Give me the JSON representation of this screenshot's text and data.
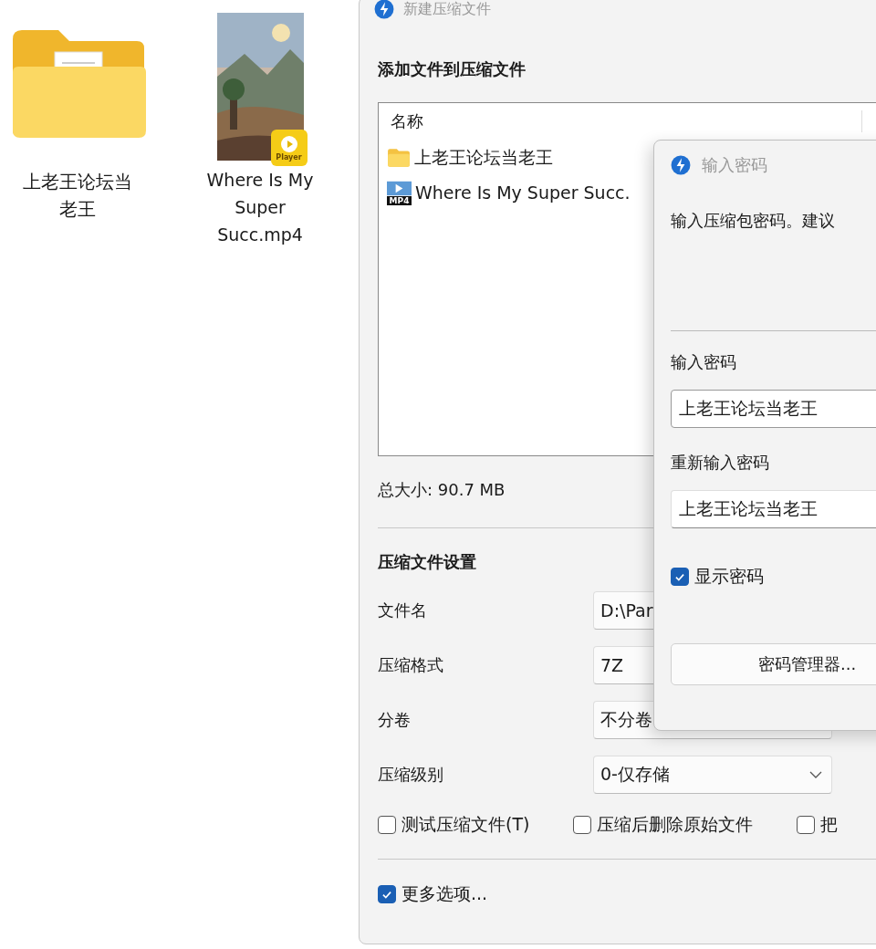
{
  "desktop_icons": [
    {
      "kind": "folder",
      "label": "上老王论坛当老王"
    },
    {
      "kind": "video",
      "label": "Where Is My Super Succ.mp4",
      "badge": "Player"
    }
  ],
  "main_window": {
    "title": "新建压缩文件",
    "add_heading": "添加文件到压缩文件",
    "list_header": "名称",
    "files": [
      {
        "kind": "folder",
        "name": "上老王论坛当老王"
      },
      {
        "kind": "video",
        "name": "Where Is My Super Succ.",
        "icon_label": "MP4"
      }
    ],
    "total_size": "总大小: 90.7 MB",
    "settings_heading": "压缩文件设置",
    "settings": [
      {
        "label": "文件名",
        "value": "D:\\Par",
        "kind": "input"
      },
      {
        "label": "压缩格式",
        "value": "7Z",
        "kind": "input"
      },
      {
        "label": "分卷",
        "value": "不分卷",
        "kind": "input"
      },
      {
        "label": "压缩级别",
        "value": "0-仅存储",
        "kind": "dropdown"
      }
    ],
    "options": [
      {
        "label": "测试压缩文件(T)",
        "checked": false
      },
      {
        "label": "压缩后删除原始文件",
        "checked": false
      },
      {
        "label": "把",
        "checked": false
      }
    ],
    "more_options": {
      "label": "更多选项...",
      "checked": true
    }
  },
  "password_dialog": {
    "title": "输入密码",
    "description": "输入压缩包密码。建议",
    "password_label": "输入密码",
    "password": "上老王论坛当老王",
    "confirm_label": "重新输入密码",
    "confirm": "上老王论坛当老王",
    "show_password": {
      "label": "显示密码",
      "checked": true
    },
    "manager_button": "密码管理器..."
  }
}
